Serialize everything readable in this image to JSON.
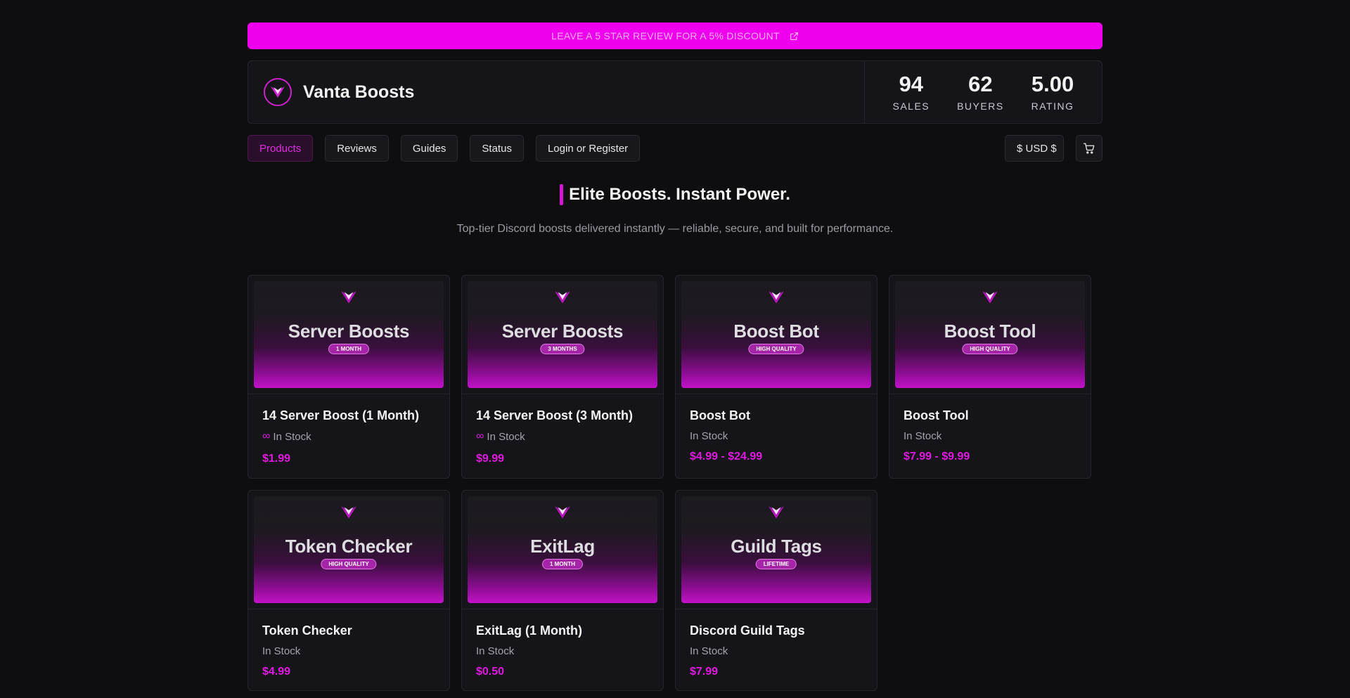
{
  "banner": {
    "text": "LEAVE A 5 STAR REVIEW FOR A 5% DISCOUNT",
    "icon": "external-link-icon"
  },
  "store": {
    "name": "Vanta Boosts",
    "logo_icon": "v-chevron-logo-icon"
  },
  "stats": [
    {
      "value": "94",
      "label": "SALES"
    },
    {
      "value": "62",
      "label": "BUYERS"
    },
    {
      "value": "5.00",
      "label": "RATING"
    }
  ],
  "nav": {
    "items": [
      "Products",
      "Reviews",
      "Guides",
      "Status",
      "Login or Register"
    ],
    "active": "Products",
    "currency": "$ USD $",
    "cart_icon": "cart-icon"
  },
  "hero": {
    "title": "Elite Boosts. Instant Power.",
    "subtitle": "Top-tier Discord boosts delivered instantly — reliable, secure, and built for performance."
  },
  "products": [
    {
      "thumb_title": "Server Boosts",
      "thumb_badge": "1 MONTH",
      "name": "14 Server Boost (1 Month)",
      "stock": "In Stock",
      "infinite": true,
      "price": "$1.99"
    },
    {
      "thumb_title": "Server Boosts",
      "thumb_badge": "3 MONTHS",
      "name": "14 Server Boost (3 Month)",
      "stock": "In Stock",
      "infinite": true,
      "price": "$9.99"
    },
    {
      "thumb_title": "Boost Bot",
      "thumb_badge": "HIGH QUALITY",
      "name": "Boost Bot",
      "stock": "In Stock",
      "infinite": false,
      "price": "$4.99 - $24.99"
    },
    {
      "thumb_title": "Boost Tool",
      "thumb_badge": "HIGH QUALITY",
      "name": "Boost Tool",
      "stock": "In Stock",
      "infinite": false,
      "price": "$7.99 - $9.99"
    },
    {
      "thumb_title": "Token Checker",
      "thumb_badge": "HIGH QUALITY",
      "name": "Token Checker",
      "stock": "In Stock",
      "infinite": false,
      "price": "$4.99"
    },
    {
      "thumb_title": "ExitLag",
      "thumb_badge": "1 MONTH",
      "name": "ExitLag (1 Month)",
      "stock": "In Stock",
      "infinite": false,
      "price": "$0.50"
    },
    {
      "thumb_title": "Guild Tags",
      "thumb_badge": "LIFETIME",
      "name": "Discord Guild Tags",
      "stock": "In Stock",
      "infinite": false,
      "price": "$7.99"
    }
  ],
  "colors": {
    "accent": "#ee00ee",
    "price": "#e019e0",
    "background": "#0e0e11"
  }
}
